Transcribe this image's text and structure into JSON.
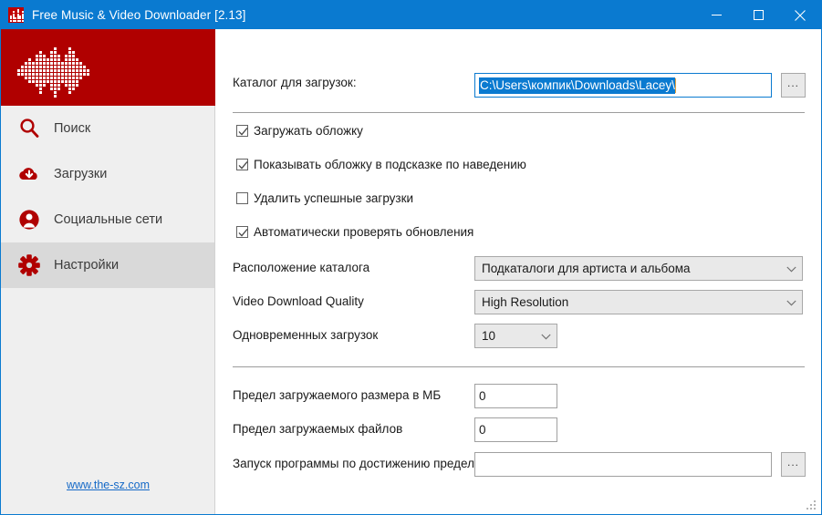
{
  "window": {
    "title": "Free Music & Video Downloader [2.13]",
    "icon": "equalizer-icon",
    "controls": {
      "minimize": "minimize-icon",
      "maximize": "maximize-icon",
      "close": "close-icon"
    },
    "accent_color": "#0a7ad0",
    "brand_color": "#b00000"
  },
  "sidebar": {
    "logo": "audio-waveform-logo",
    "items": [
      {
        "label": "Поиск",
        "icon": "search-icon",
        "selected": false
      },
      {
        "label": "Загрузки",
        "icon": "cloud-download-icon",
        "selected": false
      },
      {
        "label": "Социальные сети",
        "icon": "user-icon",
        "selected": false
      },
      {
        "label": "Настройки",
        "icon": "gear-icon",
        "selected": true
      }
    ],
    "link": "www.the-sz.com"
  },
  "main": {
    "download_dir": {
      "label": "Каталог для загрузок:",
      "value": "C:\\Users\\компик\\Downloads\\Lacey\\",
      "selected": true,
      "browse_label": "..."
    },
    "checkboxes": [
      {
        "label": "Загружать обложку",
        "checked": true
      },
      {
        "label": "Показывать обложку в подсказке по наведению",
        "checked": true
      },
      {
        "label": "Удалить успешные загрузки",
        "checked": false
      },
      {
        "label": "Автоматически проверять обновления",
        "checked": true
      }
    ],
    "selects": [
      {
        "label": "Расположение каталога",
        "value": "Подкаталоги для артиста и альбома"
      },
      {
        "label": "Video Download Quality",
        "value": "High Resolution"
      },
      {
        "label": "Одновременных загрузок",
        "value": "10"
      }
    ],
    "limits": [
      {
        "label": "Предел загружаемого размера в МБ",
        "value": "0"
      },
      {
        "label": "Предел загружаемых файлов",
        "value": "0"
      }
    ],
    "run_program": {
      "label": "Запуск программы по достижению предела",
      "value": "",
      "browse_label": "..."
    }
  }
}
